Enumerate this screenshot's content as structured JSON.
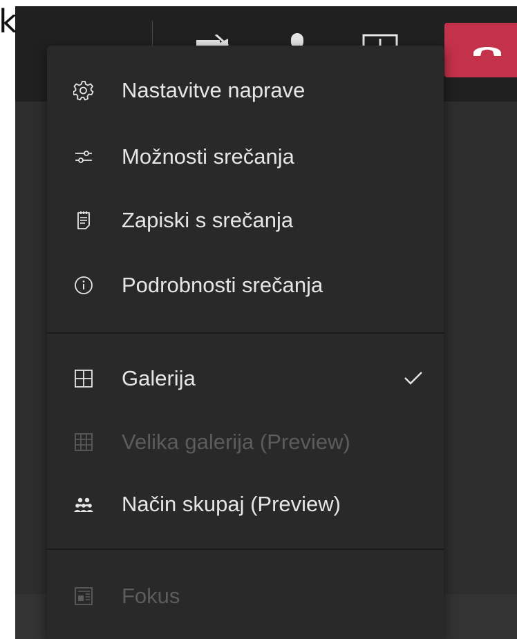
{
  "corner_text": "k",
  "toolbar": {
    "icons": [
      "video-off-icon",
      "microphone-icon",
      "share-screen-icon"
    ],
    "hangup_icon": "hang-up-phone-icon",
    "colors": {
      "hangup": "#c4314b",
      "bar": "#202020"
    }
  },
  "menu": {
    "items": [
      {
        "label": "Nastavitve naprave",
        "icon": "gear-icon",
        "disabled": false
      },
      {
        "label": "Možnosti srečanja",
        "icon": "sliders-icon",
        "disabled": false
      },
      {
        "label": "Zapiski s srečanja",
        "icon": "notepad-icon",
        "disabled": false
      },
      {
        "label": "Podrobnosti srečanja",
        "icon": "info-icon",
        "disabled": false
      },
      {
        "label": "Galerija",
        "icon": "gallery-grid-icon",
        "disabled": false,
        "checked": true
      },
      {
        "label": "Velika galerija (Preview)",
        "icon": "large-gallery-grid-icon",
        "disabled": true
      },
      {
        "label": "Način skupaj (Preview)",
        "icon": "together-mode-icon",
        "disabled": false
      },
      {
        "label": "Fokus",
        "icon": "focus-icon",
        "disabled": true
      }
    ],
    "colors": {
      "background": "#292929",
      "text": "#e6e6e6",
      "disabled_text": "#5c5c5c"
    }
  }
}
